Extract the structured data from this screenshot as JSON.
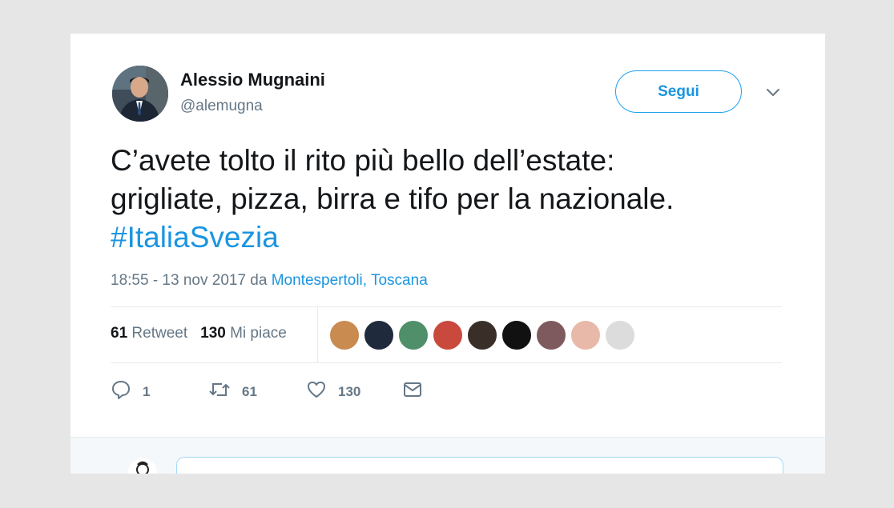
{
  "tweet": {
    "author_name": "Alessio Mugnaini",
    "author_handle": "@alemugna",
    "follow_label": "Segui",
    "text_line1": "C’avete tolto il rito più bello dell’estate:",
    "text_line2": "grigliate, pizza, birra e tifo per la nazionale.",
    "hashtag": "#ItaliaSvezia",
    "timestamp": "18:55 - 13 nov 2017 da ",
    "location": "Montespertoli, Toscana"
  },
  "stats": {
    "retweets_count": "61",
    "retweets_label": "Retweet",
    "likes_count": "130",
    "likes_label": "Mi piace"
  },
  "likers": [
    {
      "color": "#c98b4f"
    },
    {
      "color": "#1f2a3c"
    },
    {
      "color": "#4f8f6a"
    },
    {
      "color": "#c94a3c"
    },
    {
      "color": "#3a2f28"
    },
    {
      "color": "#111111"
    },
    {
      "color": "#7e5a5f"
    },
    {
      "color": "#e8b9a8"
    },
    {
      "color": "#dcdcdc"
    }
  ],
  "actions": {
    "reply_count": "1",
    "retweet_count": "61",
    "like_count": "130"
  },
  "icons": [
    "chevron-down-icon",
    "reply-icon",
    "retweet-icon",
    "heart-icon",
    "mail-icon"
  ],
  "colors": {
    "accent": "#1da1f2",
    "link": "#1b95e0",
    "text": "#14171a",
    "muted": "#657786"
  }
}
